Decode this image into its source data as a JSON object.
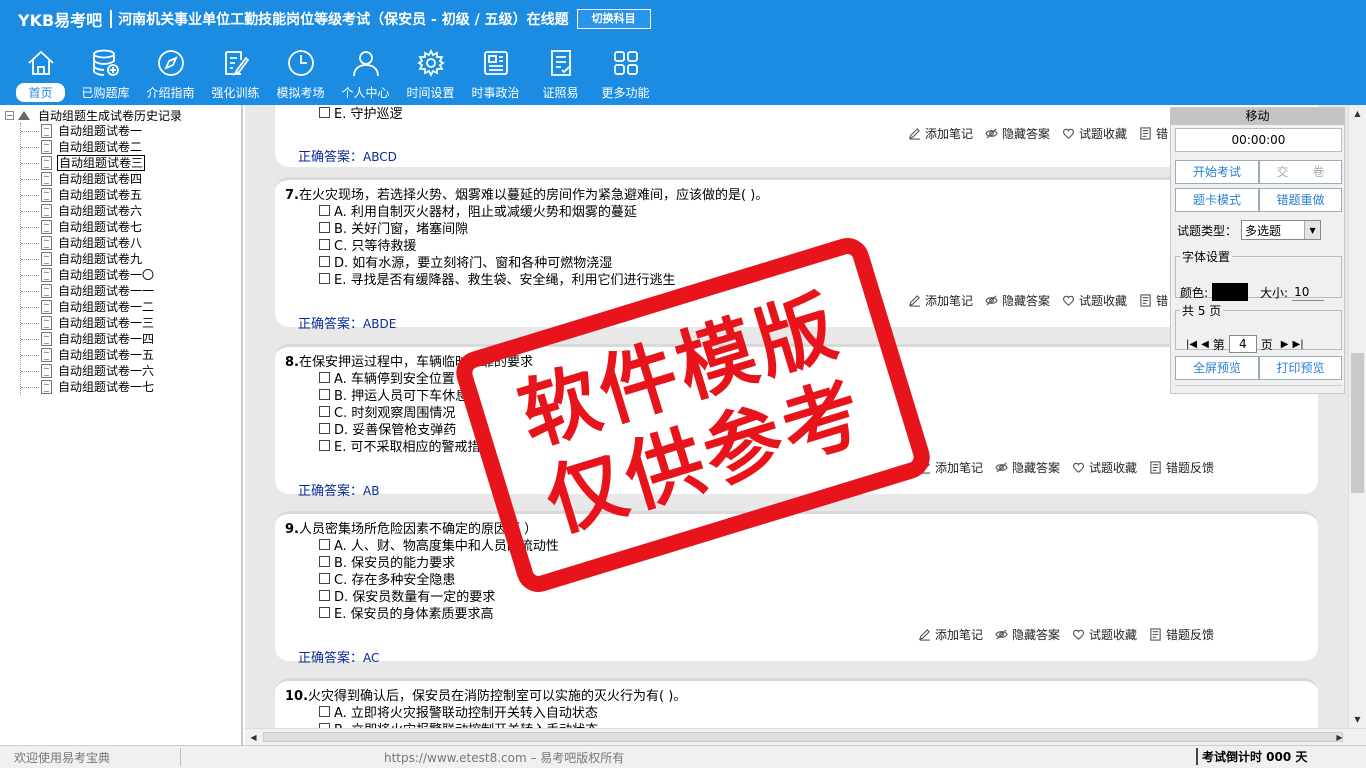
{
  "header": {
    "logo": "YKB易考吧",
    "title": "河南机关事业单位工勤技能岗位等级考试（保安员 - 初级 / 五级）在线题",
    "switch_label": "切换科目"
  },
  "nav": [
    {
      "label": "首页",
      "icon": "home-icon"
    },
    {
      "label": "已购题库",
      "icon": "database-icon"
    },
    {
      "label": "介绍指南",
      "icon": "compass-icon"
    },
    {
      "label": "强化训练",
      "icon": "edit-icon"
    },
    {
      "label": "模拟考场",
      "icon": "clock-icon"
    },
    {
      "label": "个人中心",
      "icon": "user-icon"
    },
    {
      "label": "时间设置",
      "icon": "gear-icon"
    },
    {
      "label": "时事政治",
      "icon": "news-icon"
    },
    {
      "label": "证照易",
      "icon": "certificate-icon"
    },
    {
      "label": "更多功能",
      "icon": "grid-icon"
    }
  ],
  "tree": {
    "root_label": "自动组题生成试卷历史记录",
    "toggle": "−",
    "items": [
      "自动组题试卷一",
      "自动组题试卷二",
      "自动组题试卷三",
      "自动组题试卷四",
      "自动组题试卷五",
      "自动组题试卷六",
      "自动组题试卷七",
      "自动组题试卷八",
      "自动组题试卷九",
      "自动组题试卷一〇",
      "自动组题试卷一一",
      "自动组题试卷一二",
      "自动组题试卷一三",
      "自动组题试卷一四",
      "自动组题试卷一五",
      "自动组题试卷一六",
      "自动组题试卷一七"
    ],
    "selected_index": 2
  },
  "tools": {
    "note": "添加笔记",
    "hide": "隐藏答案",
    "fav": "试题收藏",
    "report": "错题反馈",
    "report_short": "错"
  },
  "answer_label": "正确答案：",
  "prev_question": {
    "last_option": "E. 守护巡逻",
    "answer": "ABCD"
  },
  "questions": [
    {
      "num": "7.",
      "text": "在火灾现场，若选择火势、烟雾难以蔓延的房间作为紧急避难间，应该做的是( )。",
      "options": [
        "A. 利用自制灭火器材，阻止或减缓火势和烟雾的蔓延",
        "B. 关好门窗，堵塞间隙",
        "C. 只等待救援",
        "D. 如有水源，要立刻将门、窗和各种可燃物浇湿",
        "E. 寻找是否有缓降器、救生袋、安全绳，利用它们进行逃生"
      ],
      "answer": "ABDE"
    },
    {
      "num": "8.",
      "text": "在保安押运过程中，车辆临时停靠的要求",
      "options": [
        "A. 车辆停到安全位置",
        "B. 押运人员可下车休息",
        "C. 时刻观察周围情况",
        "D. 妥善保管枪支弹药",
        "E. 可不采取相应的警戒措施"
      ],
      "answer": "AB"
    },
    {
      "num": "9.",
      "text": "人员密集场所危险因素不确定的原因（ ）",
      "options": [
        "A. 人、财、物高度集中和人员的流动性",
        "B. 保安员的能力要求",
        "C. 存在多种安全隐患",
        "D. 保安员数量有一定的要求",
        "E. 保安员的身体素质要求高"
      ],
      "answer": "AC"
    },
    {
      "num": "10.",
      "text": "火灾得到确认后，保安员在消防控制室可以实施的灭火行为有( )。",
      "options": [
        "A. 立即将火灾报警联动控制开关转入自动状态",
        "B. 立即将火灾报警联动控制开关转入手动状态"
      ],
      "answer": ""
    }
  ],
  "control": {
    "title": "移动",
    "timer": "00:00:00",
    "start_exam": "开始考试",
    "submit": "交　　卷",
    "card_mode": "题卡模式",
    "wrong_redo": "错题重做",
    "type_label": "试题类型：",
    "type_value": "多选题",
    "font_group": "字体设置",
    "color_label": "颜色:",
    "font_color": "#000000",
    "size_label": "大小:",
    "size_value": "10",
    "total_pages": "共 5 页",
    "page_prefix": "第",
    "page_value": "4",
    "page_suffix": "页",
    "fullscreen": "全屏预览",
    "print": "打印预览"
  },
  "status": {
    "welcome": "欢迎使用易考宝典",
    "url": "https://www.etest8.com – 易考吧版权所有",
    "countdown": "考试倒计时 000 天"
  },
  "watermark": {
    "line1": "软件模版",
    "line2": "仅供参考",
    "color": "#e8141c"
  },
  "colors": {
    "header_bg": "#1c8ce3",
    "answer_text": "#0a2a9a"
  }
}
